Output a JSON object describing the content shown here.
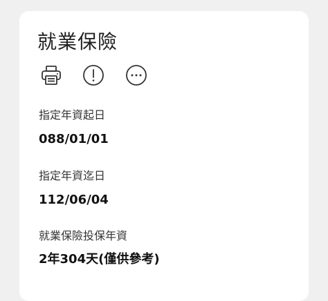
{
  "card": {
    "title": "就業保險",
    "actions": [
      {
        "icon": "printer-icon"
      },
      {
        "icon": "info-icon"
      },
      {
        "icon": "more-icon"
      }
    ],
    "fields": [
      {
        "label": "指定年資起日",
        "value": "088/01/01"
      },
      {
        "label": "指定年資迄日",
        "value": "112/06/04"
      },
      {
        "label": "就業保險投保年資",
        "value": "2年304天(僅供參考)"
      }
    ]
  },
  "colors": {
    "background": "#f0f0f0",
    "card": "#ffffff",
    "text": "#222222",
    "icon_stroke": "#333333"
  }
}
